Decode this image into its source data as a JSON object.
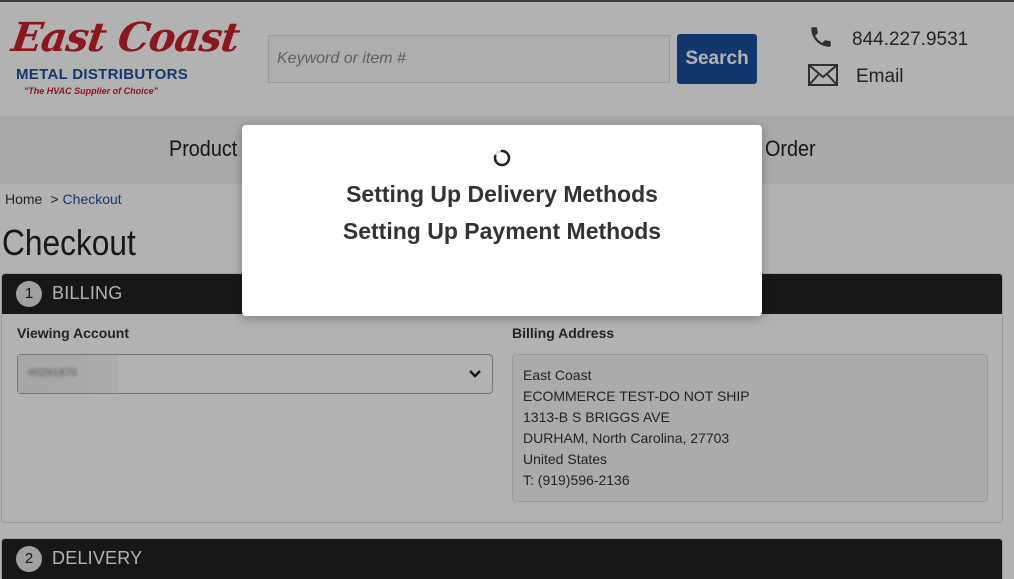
{
  "header": {
    "logo": {
      "script_text": "East Coast",
      "name": "METAL DISTRIBUTORS",
      "tagline": "\"The HVAC Supplier of Choice\""
    },
    "search": {
      "placeholder": "Keyword or item #",
      "button_label": "Search"
    },
    "phone": {
      "number": "844.227.9531",
      "icon": "phone-icon"
    },
    "email": {
      "label": "Email",
      "icon": "envelope-icon"
    }
  },
  "nav": {
    "items": [
      {
        "label": "Product C"
      },
      {
        "label": "Order"
      }
    ]
  },
  "breadcrumb": {
    "home": "Home",
    "separator": ">",
    "current": "Checkout"
  },
  "page": {
    "title": "Checkout"
  },
  "billing": {
    "step": "1",
    "title": "BILLING",
    "viewing_account_label": "Viewing Account",
    "account_value": "#0291876",
    "billing_address_label": "Billing Address",
    "address_lines": [
      "East Coast",
      "ECOMMERCE TEST-DO NOT SHIP",
      "1313-B S BRIGGS AVE",
      "DURHAM, North Carolina, 27703",
      "United States",
      "T: (919)596-2136"
    ]
  },
  "delivery": {
    "step": "2",
    "title": "DELIVERY"
  },
  "modal": {
    "line1": "Setting Up Delivery Methods",
    "line2": "Setting Up Payment Methods"
  },
  "colors": {
    "brand_red": "#c8202a",
    "brand_blue": "#1c4f9c",
    "panel_header": "#222222"
  }
}
